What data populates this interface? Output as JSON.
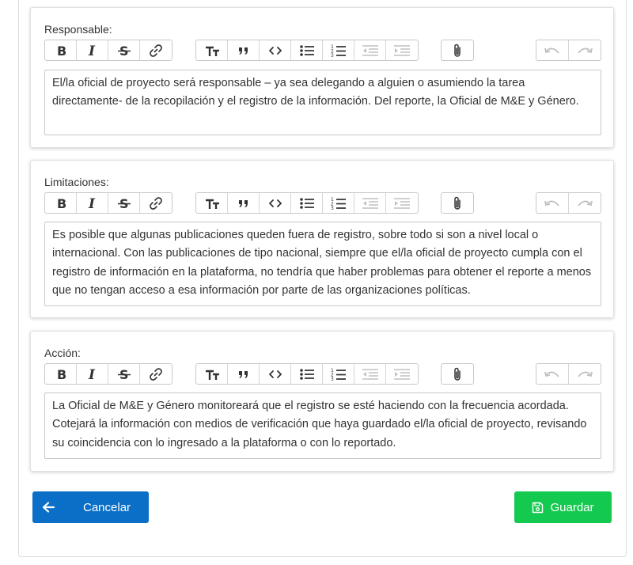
{
  "sections": [
    {
      "label": "Responsable:",
      "content": "El/la oficial de proyecto será responsable – ya sea delegando a alguien o asumiendo la tarea directamente- de la recopilación y el registro de la información. Del reporte, la Oficial de M&E y Género."
    },
    {
      "label": "Limitaciones:",
      "content": "Es posible que algunas publicaciones queden fuera de registro, sobre todo si son a nivel local o internacional. Con las publicaciones de tipo nacional, siempre que el/la oficial de proyecto cumpla con el registro de información en la plataforma, no tendría que haber problemas para obtener el reporte a menos que no tengan acceso a esa información por parte de las organizaciones políticas."
    },
    {
      "label": "Acción:",
      "content": "La Oficial de M&E y Género monitoreará que el registro se esté haciendo con la frecuencia acordada. Cotejará la información con medios de verificación que haya guardado el/la oficial de proyecto, revisando su coincidencia con lo ingresado a la plataforma o con lo reportado."
    }
  ],
  "toolbar_icons": [
    "bold-icon",
    "italic-icon",
    "strikethrough-icon",
    "link-icon",
    "heading-icon",
    "quote-icon",
    "code-icon",
    "bullet-list-icon",
    "numbered-list-icon",
    "decrease-indent-icon",
    "increase-indent-icon",
    "attach-icon",
    "undo-icon",
    "redo-icon"
  ],
  "buttons": {
    "cancel_label": "Cancelar",
    "save_label": "Guardar"
  },
  "colors": {
    "cancel": "#0b6fc7",
    "save": "#14c94f"
  }
}
